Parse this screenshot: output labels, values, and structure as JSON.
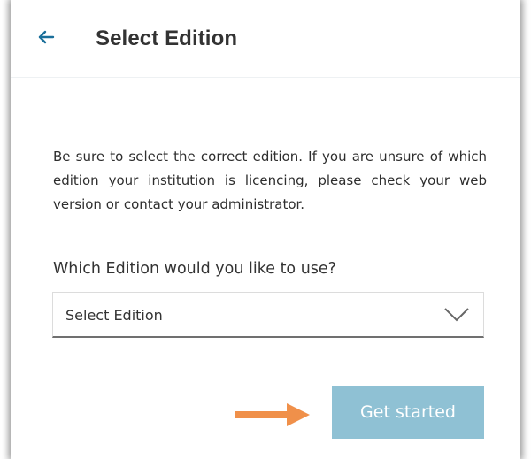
{
  "header": {
    "back_icon": "arrow-left-icon",
    "title": "Select Edition"
  },
  "main": {
    "info_text": "Be sure to select the correct edition. If you are unsure of which edition your institution is licencing, please check your web version or contact your administrator.",
    "question": "Which Edition would you like to use?",
    "edition_select": {
      "value": "Select Edition",
      "icon": "chevron-down-icon"
    },
    "pointer_icon": "arrow-right-icon",
    "get_started_label": "Get started"
  },
  "colors": {
    "accent": "#1a6f9a",
    "button_disabled": "#8fc1d4",
    "pointer": "#f0904a",
    "text": "#333333"
  }
}
